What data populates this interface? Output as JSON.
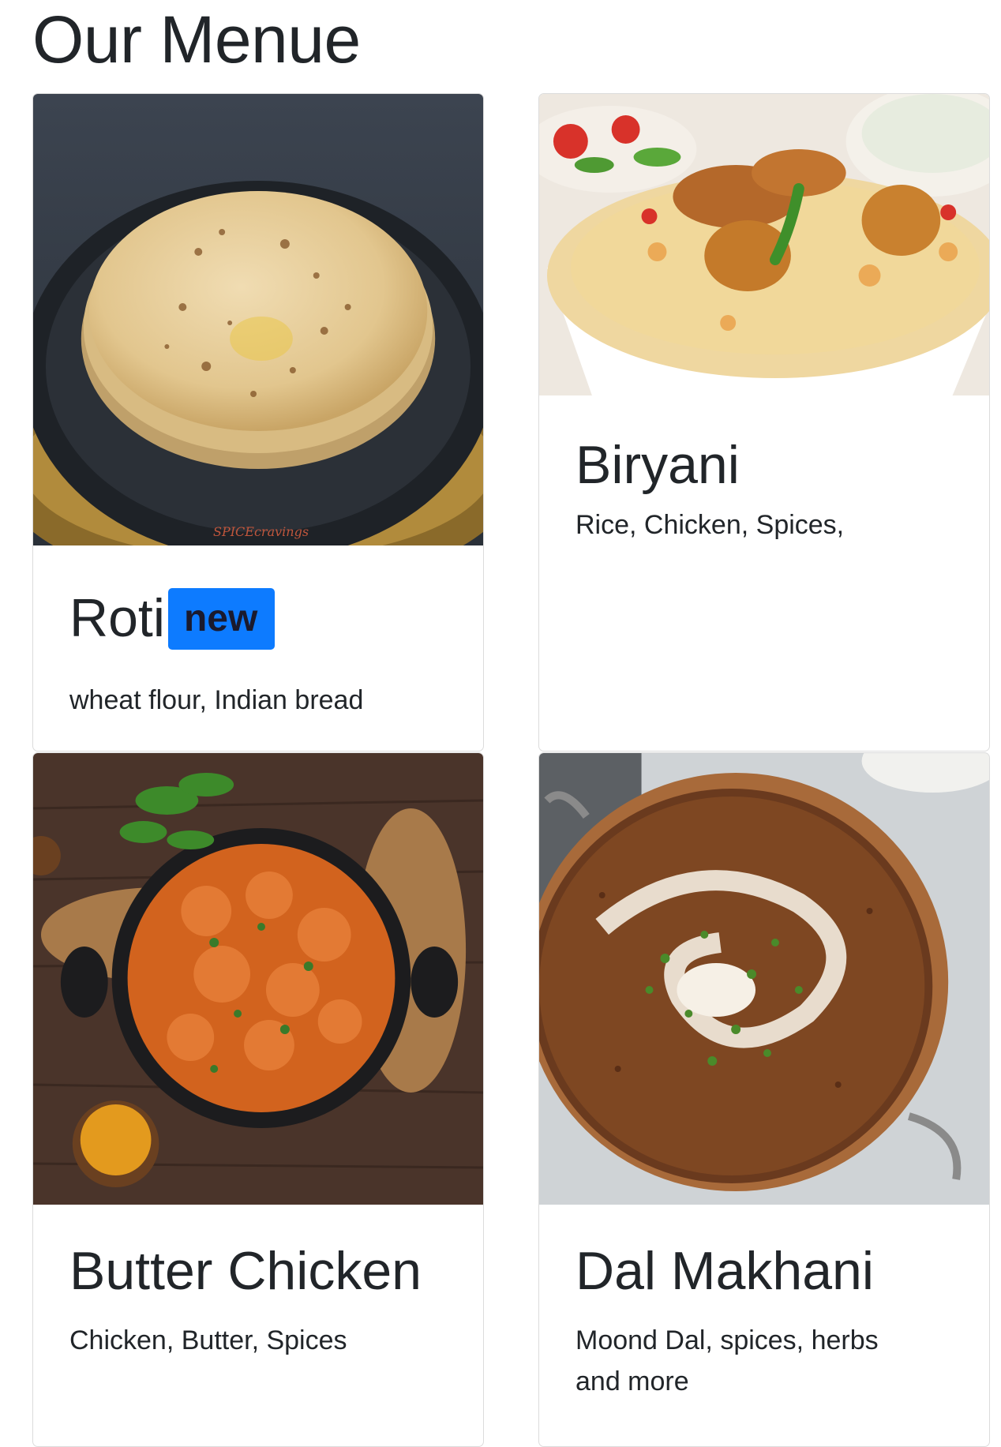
{
  "page": {
    "title": "Our Menue"
  },
  "cards": [
    {
      "title": "Roti",
      "badge": "new",
      "text": "wheat flour, Indian bread",
      "watermark": "SPICEcravings"
    },
    {
      "title": "Biryani",
      "text": "Rice, Chicken, Spices,"
    },
    {
      "title": "Butter Chicken",
      "text": "Chicken, Butter, Spices"
    },
    {
      "title": "Dal Makhani",
      "text": "Moond Dal, spices, herbs and more"
    }
  ],
  "colors": {
    "badge": "#0d7bff",
    "text": "#212529",
    "border": "#dcdcdc"
  }
}
